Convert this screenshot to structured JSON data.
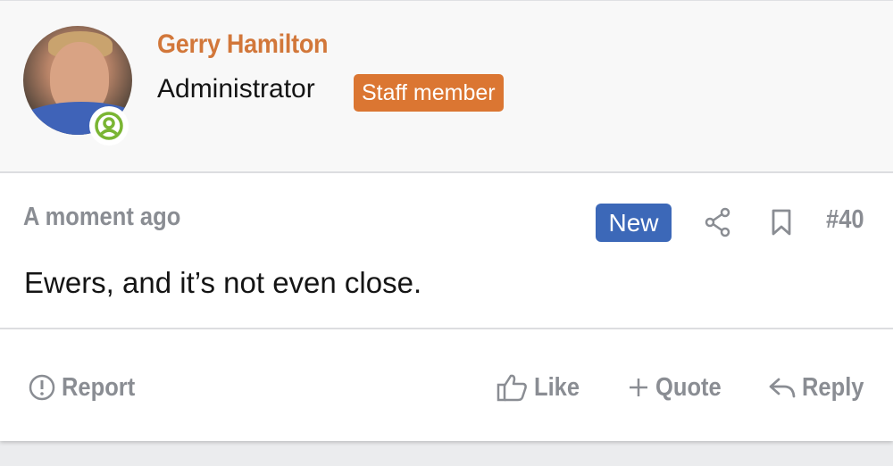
{
  "user": {
    "name": "Gerry Hamilton",
    "role": "Administrator",
    "badge": "Staff member"
  },
  "post": {
    "time": "A moment ago",
    "new_label": "New",
    "number": "#40",
    "content": "Ewers, and it’s not even close."
  },
  "actions": {
    "report": "Report",
    "like": "Like",
    "quote": "Quote",
    "reply": "Reply"
  },
  "colors": {
    "username": "#d2773a",
    "staff_badge": "#db7632",
    "new_badge": "#3c68b8",
    "online": "#7ab533",
    "muted_text": "#8a8d93"
  },
  "icons": [
    "online-status-icon",
    "share-icon",
    "bookmark-icon",
    "report-icon",
    "like-icon",
    "quote-icon",
    "reply-icon"
  ]
}
